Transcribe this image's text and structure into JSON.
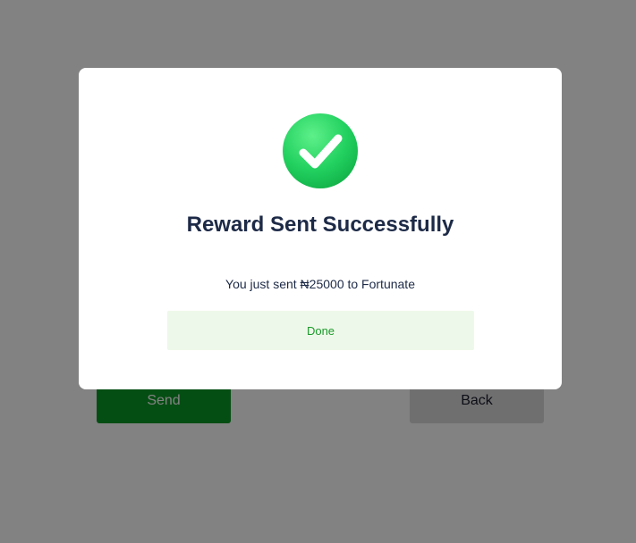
{
  "page": {
    "send_label": "Send",
    "back_label": "Back"
  },
  "modal": {
    "icon": "check-circle-icon",
    "title": "Reward Sent Successfully",
    "message": "You just sent ₦25000 to Fortunate",
    "done_label": "Done"
  },
  "colors": {
    "send_bg": "#0a9a26",
    "success_green": "#22c55e",
    "done_bg": "#eef8ea",
    "done_text": "#1a9a2a",
    "title_text": "#1d2a47"
  }
}
